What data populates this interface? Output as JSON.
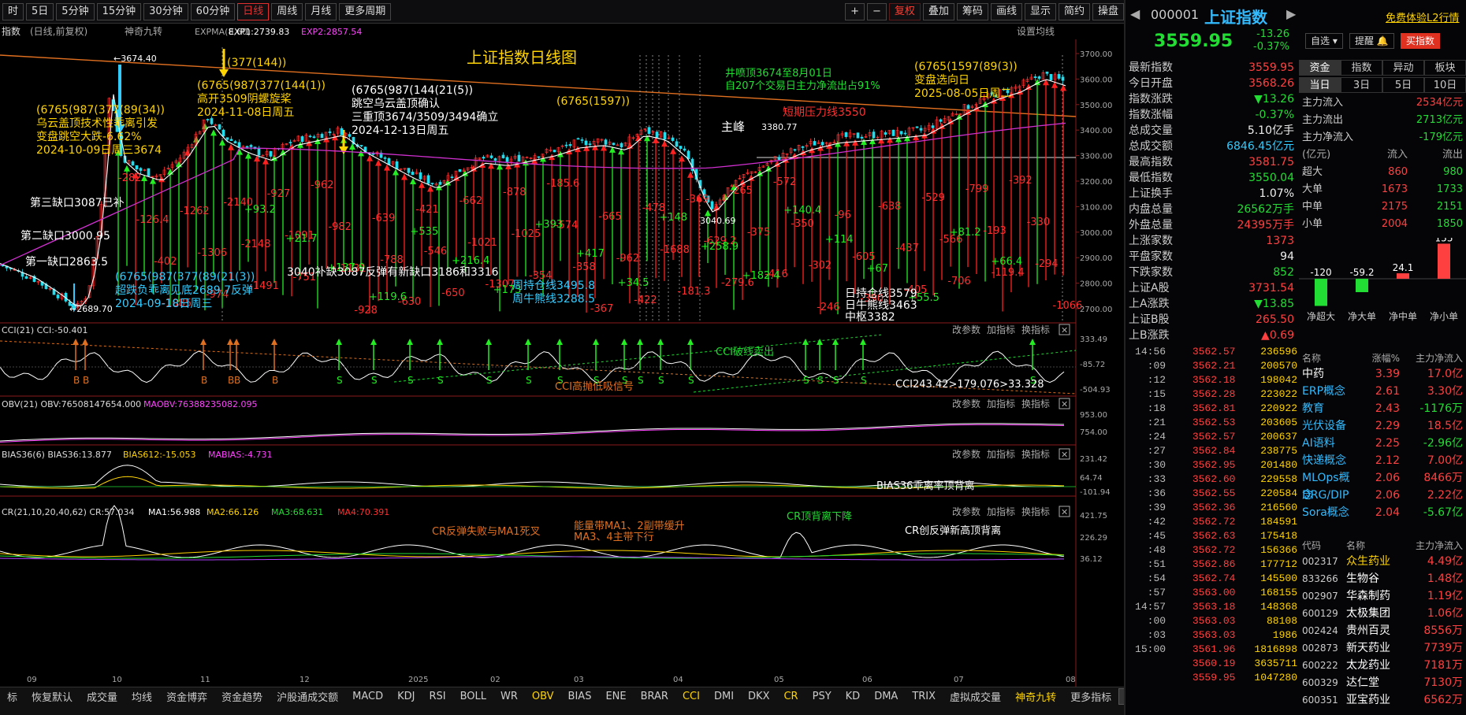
{
  "toolbar": {
    "periods": [
      "时",
      "5日",
      "5分钟",
      "15分钟",
      "30分钟",
      "60分钟",
      "日线",
      "周线",
      "月线",
      "更多周期"
    ],
    "active_period": "日线",
    "right_tools": [
      "+",
      "−",
      "复权",
      "叠加",
      "筹码",
      "画线",
      "显示",
      "简约",
      "操盘"
    ]
  },
  "legend": {
    "title_left": "指数",
    "mode": "(日线,前复权)",
    "indicator": "神奇九转",
    "expma": "EXPMA(8,60)",
    "exp1": "EXP1:2739.83",
    "exp2": "EXP2:2857.54",
    "settings": "设置均线"
  },
  "main_title": "上证指数日线图",
  "price_axis": [
    "3700.00",
    "3600.00",
    "3500.00",
    "3400.00",
    "3300.00",
    "3200.00",
    "3100.00",
    "3000.00",
    "2900.00",
    "2800.00",
    "2700.00"
  ],
  "annotations": {
    "a1": [
      "(6765(987(377(89(34))",
      "乌云盖顶技术性乖离引发",
      "变盘跳空大跌-6.62%",
      "2024-10-09日周三3674"
    ],
    "a2": [
      "(377(144))",
      "(6765(987(377(144(1))",
      "高开3509阴螺旋桨",
      "2024-11-08日周五"
    ],
    "a3": [
      "(6765(987(144(21(5))",
      "跳空乌云盖顶确认",
      "三重顶3674/3509/3494确立",
      "2024-12-13日周五"
    ],
    "a4": "(6765(1597))",
    "a5": [
      "井喷顶3674至8月01日",
      "自207个交易日主力净流出占91%"
    ],
    "a6": "短期压力线3550",
    "a7": [
      "(6765(1597(89(3))",
      "变盘选向日",
      "2025-08-05日周二"
    ],
    "gap3": "第三缺口3087已补",
    "gap2": "第二缺口3000.95",
    "gap1": "第一缺口2863.5",
    "low_note": [
      "(6765(987(377(89(21(3))",
      "超跌负乖离见底2689.7反弹",
      "2024-09-18日周三"
    ],
    "bu_que": "3040补缺3087反弹有新缺口3186和3316",
    "zhoux": [
      "周持仓线3495.8",
      "周牛熊线3288.5"
    ],
    "zhufeng": "主峰",
    "zhufeng_val": "3380.77",
    "rix": [
      "日持仓线3579",
      "日牛熊线3463",
      "中枢3382"
    ],
    "hi_mark": "←3674.40",
    "lo_mark": "←2689.70",
    "mid_mark": "3040.69"
  },
  "red_labels": [
    "-282",
    "-126.4",
    "-402",
    "-1085",
    "-1262",
    "-1306",
    "-974",
    "-2140",
    "-2148",
    "-1491",
    "-927",
    "-1091",
    "-751",
    "-962",
    "-982",
    "-1131",
    "-928",
    "-639",
    "-788",
    "-630",
    "-421",
    "-546",
    "-650",
    "-662",
    "-1021",
    "-1307",
    "-878",
    "-1025",
    "-354",
    "-185.6",
    "-574",
    "-358",
    "-367",
    "-665",
    "-962",
    "-422",
    "-478",
    "-1688",
    "-181.3",
    "-369",
    "-629.2",
    "-279.6",
    "-265",
    "-375",
    "-416",
    "-572",
    "-350",
    "-302",
    "-246",
    "-96",
    "-605",
    "-390",
    "-638",
    "-437",
    "-405",
    "-529",
    "-566",
    "-706",
    "-799",
    "-193",
    "-119.4",
    "-392",
    "-330",
    "-294",
    "-1066"
  ],
  "green_labels": [
    "+93.2",
    "+21.7",
    "+137.9",
    "+119.6",
    "+535",
    "+216.4",
    "+173",
    "+393",
    "+417",
    "+34.5",
    "+148",
    "+258.9",
    "+182.4",
    "+140.4",
    "+114",
    "+67",
    "+55.5",
    "+81.2",
    "+66.4"
  ],
  "date_axis": [
    "09",
    "10",
    "11",
    "12",
    "2025",
    "02",
    "03",
    "04",
    "05",
    "06",
    "07",
    "08"
  ],
  "cci": {
    "header": "CCI(21)  CCI:-50.401",
    "axis": [
      "333.49",
      "-85.72",
      "-504.93"
    ],
    "notes": [
      "CCI破线卖出",
      "CCI高抛低吸信号",
      "CCI243.42>179.076>33.328"
    ]
  },
  "obv": {
    "header": "OBV(21)  OBV:76508147654.000",
    "maobv": "MAOBV:76388235082.095",
    "axis": [
      "953.00",
      "754.00"
    ]
  },
  "bias": {
    "header": "BIAS36(6)  BIAS36:13.877",
    "b612": "BIAS612:-15.053",
    "mabias": "MABIAS:-4.731",
    "axis": [
      "231.42",
      "64.74",
      "-101.94"
    ],
    "note": "BIAS36乖离率顶背离"
  },
  "cr": {
    "header": "CR(21,10,20,40,62)  CR:57.034",
    "ma1": "MA1:56.988",
    "ma2": "MA2:66.126",
    "ma3": "MA3:68.631",
    "ma4": "MA4:70.391",
    "axis": [
      "421.75",
      "226.29",
      "36.12"
    ],
    "notes": [
      "CR反弹失败与MA1死叉",
      "能量带MA1、2副带缓升",
      "MA3、4主带下行",
      "CR顶背离下降",
      "CR创反弹新高顶背离"
    ]
  },
  "panel_tools": [
    "改参数",
    "加指标",
    "换指标"
  ],
  "tabs": [
    "标",
    "恢复默认",
    "成交量",
    "均线",
    "资金博弈",
    "资金趋势",
    "沪股通成交额",
    "MACD",
    "KDJ",
    "RSI",
    "BOLL",
    "WR",
    "OBV",
    "BIAS",
    "ENE",
    "BRAR",
    "CCI",
    "DMI",
    "DKX",
    "CR",
    "PSY",
    "KD",
    "DMA",
    "TRIX",
    "虚拟成交量",
    "神奇九转",
    "更多指标",
    "模板"
  ],
  "active_tabs": [
    "OBV",
    "CCI",
    "CR",
    "神奇九转"
  ],
  "right": {
    "code": "000001",
    "name": "上证指数",
    "trial": "免费体验L2行情",
    "price": "3559.95",
    "change": "-13.26",
    "pct": "-0.37%",
    "btn_zixuan": "自选",
    "btn_tixing": "提醒",
    "btn_buy": "买指数",
    "stats": [
      {
        "k": "最新指数",
        "v": "3559.95",
        "c": "red"
      },
      {
        "k": "今日开盘",
        "v": "3568.26",
        "c": "red"
      },
      {
        "k": "指数涨跌",
        "v": "▼13.26",
        "c": "grn"
      },
      {
        "k": "指数涨幅",
        "v": "-0.37%",
        "c": "grn"
      },
      {
        "k": "总成交量",
        "v": "5.10亿手",
        "c": "wh"
      },
      {
        "k": "总成交额",
        "v": "6846.45亿元",
        "c": "cyan"
      },
      {
        "k": "最高指数",
        "v": "3581.75",
        "c": "red"
      },
      {
        "k": "最低指数",
        "v": "3550.04",
        "c": "grn"
      },
      {
        "k": "上证换手",
        "v": "1.07%",
        "c": "wh"
      },
      {
        "k": "内盘总量",
        "v": "26562万手",
        "c": "grn"
      },
      {
        "k": "外盘总量",
        "v": "24395万手",
        "c": "red"
      },
      {
        "k": "上涨家数",
        "v": "1373",
        "c": "red"
      },
      {
        "k": "平盘家数",
        "v": "94",
        "c": "wh"
      },
      {
        "k": "下跌家数",
        "v": "852",
        "c": "grn"
      },
      {
        "k": "上证A股",
        "v": "3731.54",
        "c": "red"
      },
      {
        "k": "上A涨跌",
        "v": "▼13.85",
        "c": "grn"
      },
      {
        "k": "上证B股",
        "v": "265.50",
        "c": "red"
      },
      {
        "k": "上B涨跌",
        "v": "▲0.69",
        "c": "red"
      }
    ],
    "fund_tabs": [
      "资金",
      "指数",
      "异动",
      "板块"
    ],
    "period_tabs": [
      "当日",
      "3日",
      "5日",
      "10日"
    ],
    "flows": [
      {
        "k": "主力流入",
        "v": "2534亿元",
        "c": "red"
      },
      {
        "k": "主力流出",
        "v": "2713亿元",
        "c": "grn"
      },
      {
        "k": "主力净流入",
        "v": "-179亿元",
        "c": "grn"
      }
    ],
    "flow_table_hdr": [
      "(亿元)",
      "流入",
      "流出"
    ],
    "flow_table": [
      {
        "k": "超大",
        "in": "860",
        "out": "980"
      },
      {
        "k": "大单",
        "in": "1673",
        "out": "1733"
      },
      {
        "k": "中单",
        "in": "2175",
        "out": "2151"
      },
      {
        "k": "小单",
        "in": "2004",
        "out": "1850"
      }
    ],
    "bars": [
      {
        "label": "净超大",
        "value": -120
      },
      {
        "label": "净大单",
        "value": -59.2
      },
      {
        "label": "净中单",
        "value": 24.1
      },
      {
        "label": "净小单",
        "value": 155
      }
    ],
    "bar_values": [
      "-120",
      "-59.2",
      "24.1",
      "155"
    ],
    "ticks": [
      [
        "14:56",
        "3562.57",
        "236596"
      ],
      [
        ":09",
        "3562.21",
        "200570"
      ],
      [
        ":12",
        "3562.18",
        "198042"
      ],
      [
        ":15",
        "3562.28",
        "223022"
      ],
      [
        ":18",
        "3562.81",
        "220922"
      ],
      [
        ":21",
        "3562.53",
        "203605"
      ],
      [
        ":24",
        "3562.57",
        "200637"
      ],
      [
        ":27",
        "3562.84",
        "238775"
      ],
      [
        ":30",
        "3562.95",
        "201480"
      ],
      [
        ":33",
        "3562.60",
        "229558"
      ],
      [
        ":36",
        "3562.55",
        "220584"
      ],
      [
        ":39",
        "3562.36",
        "216560"
      ],
      [
        ":42",
        "3562.72",
        "184591"
      ],
      [
        ":45",
        "3562.63",
        "175418"
      ],
      [
        ":48",
        "3562.72",
        "156366"
      ],
      [
        ":51",
        "3562.86",
        "177712"
      ],
      [
        ":54",
        "3562.74",
        "145500"
      ],
      [
        ":57",
        "3563.00",
        "168155"
      ],
      [
        "14:57",
        "3563.18",
        "148368"
      ],
      [
        ":00",
        "3563.03",
        "88108"
      ],
      [
        ":03",
        "3563.03",
        "1986"
      ],
      [
        "15:00",
        "3561.96",
        "1816898"
      ],
      [
        "",
        "3560.19",
        "3635711"
      ],
      [
        "",
        "3559.95",
        "1047280"
      ]
    ],
    "sector_hdr": [
      "名称",
      "涨幅%",
      "主力净流入"
    ],
    "sectors": [
      {
        "n": "中药",
        "p": "3.39",
        "f": "17.0亿",
        "fc": "red"
      },
      {
        "n": "ERP概念",
        "p": "2.61",
        "f": "3.30亿",
        "fc": "red"
      },
      {
        "n": "教育",
        "p": "2.43",
        "f": "-1176万",
        "fc": "grn"
      },
      {
        "n": "光伏设备",
        "p": "2.29",
        "f": "18.5亿",
        "fc": "red"
      },
      {
        "n": "AI语料",
        "p": "2.25",
        "f": "-2.96亿",
        "fc": "grn"
      },
      {
        "n": "快递概念",
        "p": "2.12",
        "f": "7.00亿",
        "fc": "red"
      },
      {
        "n": "MLOps概念",
        "p": "2.06",
        "f": "8466万",
        "fc": "red"
      },
      {
        "n": "DRG/DIP",
        "p": "2.06",
        "f": "2.22亿",
        "fc": "red"
      },
      {
        "n": "Sora概念",
        "p": "2.04",
        "f": "-5.67亿",
        "fc": "grn"
      }
    ],
    "stock_hdr": [
      "代码",
      "名称",
      "主力净流入"
    ],
    "stocks": [
      {
        "c": "002317",
        "n": "众生药业",
        "f": "4.49亿"
      },
      {
        "c": "833266",
        "n": "生物谷",
        "f": "1.48亿"
      },
      {
        "c": "002907",
        "n": "华森制药",
        "f": "1.19亿"
      },
      {
        "c": "600129",
        "n": "太极集团",
        "f": "1.06亿"
      },
      {
        "c": "002424",
        "n": "贵州百灵",
        "f": "8556万"
      },
      {
        "c": "002873",
        "n": "新天药业",
        "f": "7739万"
      },
      {
        "c": "600222",
        "n": "太龙药业",
        "f": "7181万"
      },
      {
        "c": "600329",
        "n": "达仁堂",
        "f": "7130万"
      },
      {
        "c": "600351",
        "n": "亚宝药业",
        "f": "6562万"
      }
    ]
  }
}
